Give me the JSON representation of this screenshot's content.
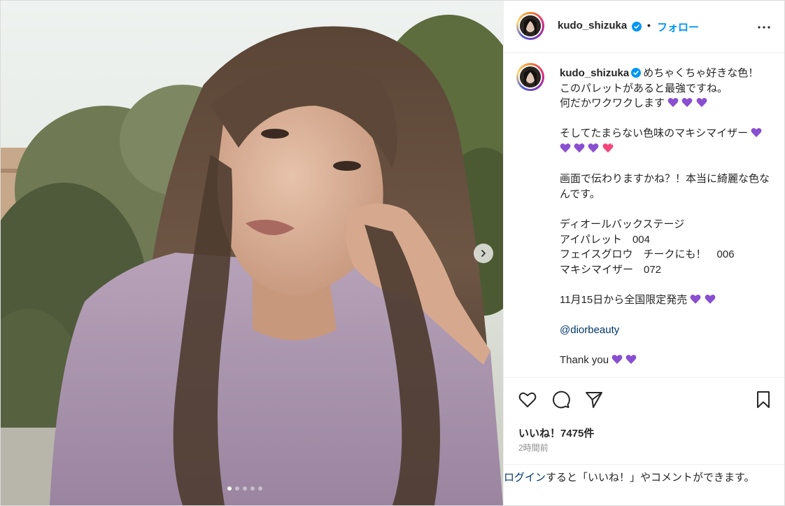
{
  "post": {
    "username": "kudo_shizuka",
    "separator": "•",
    "follow_label": "フォロー",
    "more_icon": "more-options-icon",
    "carousel": {
      "total_slides": 5,
      "active_slide": 1
    }
  },
  "caption": {
    "username": "kudo_shizuka",
    "lines": [
      "めちゃくちゃ好きな色！",
      "このパレットがあると最強ですね。",
      "何だかワクワクします",
      "",
      "そしてたまらない色味のマキシマイザー",
      "",
      "画面で伝わりますかね？！本当に綺麗な色なんです。",
      "",
      "ディオールバックステージ",
      "アイパレット　004",
      "フェイスグロウ　チークにも！　006",
      "マキシマイザー　072",
      "",
      "11月15日から全国限定発売",
      "",
      "@diorbeauty",
      "",
      "Thank you"
    ],
    "mention": "@diorbeauty"
  },
  "actions": {
    "like_icon": "heart-outline-icon",
    "comment_icon": "comment-bubble-icon",
    "share_icon": "paper-plane-icon",
    "save_icon": "bookmark-icon"
  },
  "stats": {
    "likes": "いいね！7475件",
    "time": "2時間前"
  },
  "login": {
    "link": "ログイン",
    "text": "すると「いいね！」やコメントができます。"
  },
  "colors": {
    "link_blue": "#0095f6",
    "mention": "#00376b",
    "purple_heart": "#8a4fd1",
    "verified": "#0095f6"
  }
}
